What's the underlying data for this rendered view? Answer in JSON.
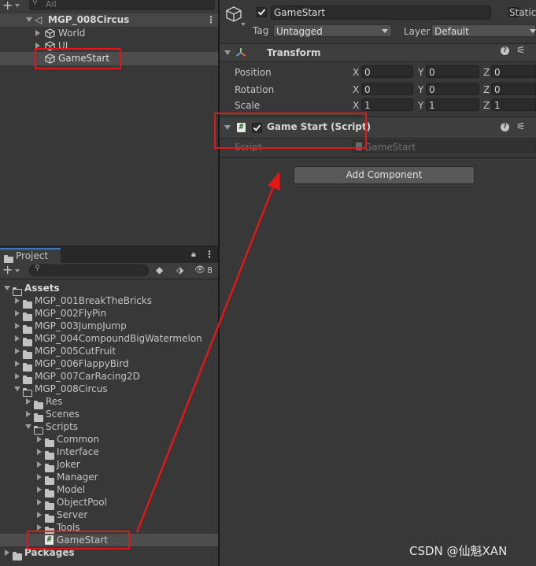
{
  "hierarchy": {
    "search_placeholder": "All",
    "scene_name": "MGP_008Circus",
    "items": [
      {
        "label": "World"
      },
      {
        "label": "UI"
      },
      {
        "label": "GameStart"
      }
    ]
  },
  "project": {
    "tab_label": "Project",
    "hidden_count": "8",
    "tree": [
      {
        "label": "Assets",
        "indent": 0,
        "expanded": true,
        "kind": "folder"
      },
      {
        "label": "MGP_001BreakTheBricks",
        "indent": 1,
        "expanded": false,
        "kind": "folder"
      },
      {
        "label": "MGP_002FlyPin",
        "indent": 1,
        "expanded": false,
        "kind": "folder"
      },
      {
        "label": "MGP_003JumpJump",
        "indent": 1,
        "expanded": false,
        "kind": "folder"
      },
      {
        "label": "MGP_004CompoundBigWatermelon",
        "indent": 1,
        "expanded": false,
        "kind": "folder"
      },
      {
        "label": "MGP_005CutFruit",
        "indent": 1,
        "expanded": false,
        "kind": "folder"
      },
      {
        "label": "MGP_006FlappyBird",
        "indent": 1,
        "expanded": false,
        "kind": "folder"
      },
      {
        "label": "MGP_007CarRacing2D",
        "indent": 1,
        "expanded": false,
        "kind": "folder"
      },
      {
        "label": "MGP_008Circus",
        "indent": 1,
        "expanded": true,
        "kind": "folder"
      },
      {
        "label": "Res",
        "indent": 2,
        "expanded": false,
        "kind": "folder"
      },
      {
        "label": "Scenes",
        "indent": 2,
        "expanded": false,
        "kind": "folder"
      },
      {
        "label": "Scripts",
        "indent": 2,
        "expanded": true,
        "kind": "folder"
      },
      {
        "label": "Common",
        "indent": 3,
        "expanded": false,
        "kind": "folder"
      },
      {
        "label": "Interface",
        "indent": 3,
        "expanded": false,
        "kind": "folder"
      },
      {
        "label": "Joker",
        "indent": 3,
        "expanded": false,
        "kind": "folder"
      },
      {
        "label": "Manager",
        "indent": 3,
        "expanded": false,
        "kind": "folder"
      },
      {
        "label": "Model",
        "indent": 3,
        "expanded": false,
        "kind": "folder"
      },
      {
        "label": "ObjectPool",
        "indent": 3,
        "expanded": false,
        "kind": "folder"
      },
      {
        "label": "Server",
        "indent": 3,
        "expanded": false,
        "kind": "folder"
      },
      {
        "label": "Tools",
        "indent": 3,
        "expanded": false,
        "kind": "folder"
      },
      {
        "label": "GameStart",
        "indent": 3,
        "expanded": false,
        "kind": "script"
      },
      {
        "label": "Packages",
        "indent": 0,
        "expanded": false,
        "kind": "folder"
      }
    ]
  },
  "inspector": {
    "object_name": "GameStart",
    "static_label": "Static",
    "tag_label": "Tag",
    "tag_value": "Untagged",
    "layer_label": "Layer",
    "layer_value": "Default",
    "transform": {
      "title": "Transform",
      "position_label": "Position",
      "rotation_label": "Rotation",
      "scale_label": "Scale",
      "axis_x": "X",
      "axis_y": "Y",
      "axis_z": "Z",
      "position": [
        "0",
        "0",
        "0"
      ],
      "rotation": [
        "0",
        "0",
        "0"
      ],
      "scale": [
        "1",
        "1",
        "1"
      ]
    },
    "script_component": {
      "title": "Game Start (Script)",
      "script_label": "Script",
      "script_value": "GameStart"
    },
    "add_component_label": "Add Component"
  },
  "watermark": "CSDN @仙魁XAN",
  "colors": {
    "highlight": "#e01818",
    "panel": "#383838",
    "selection": "#4d4d4d"
  }
}
